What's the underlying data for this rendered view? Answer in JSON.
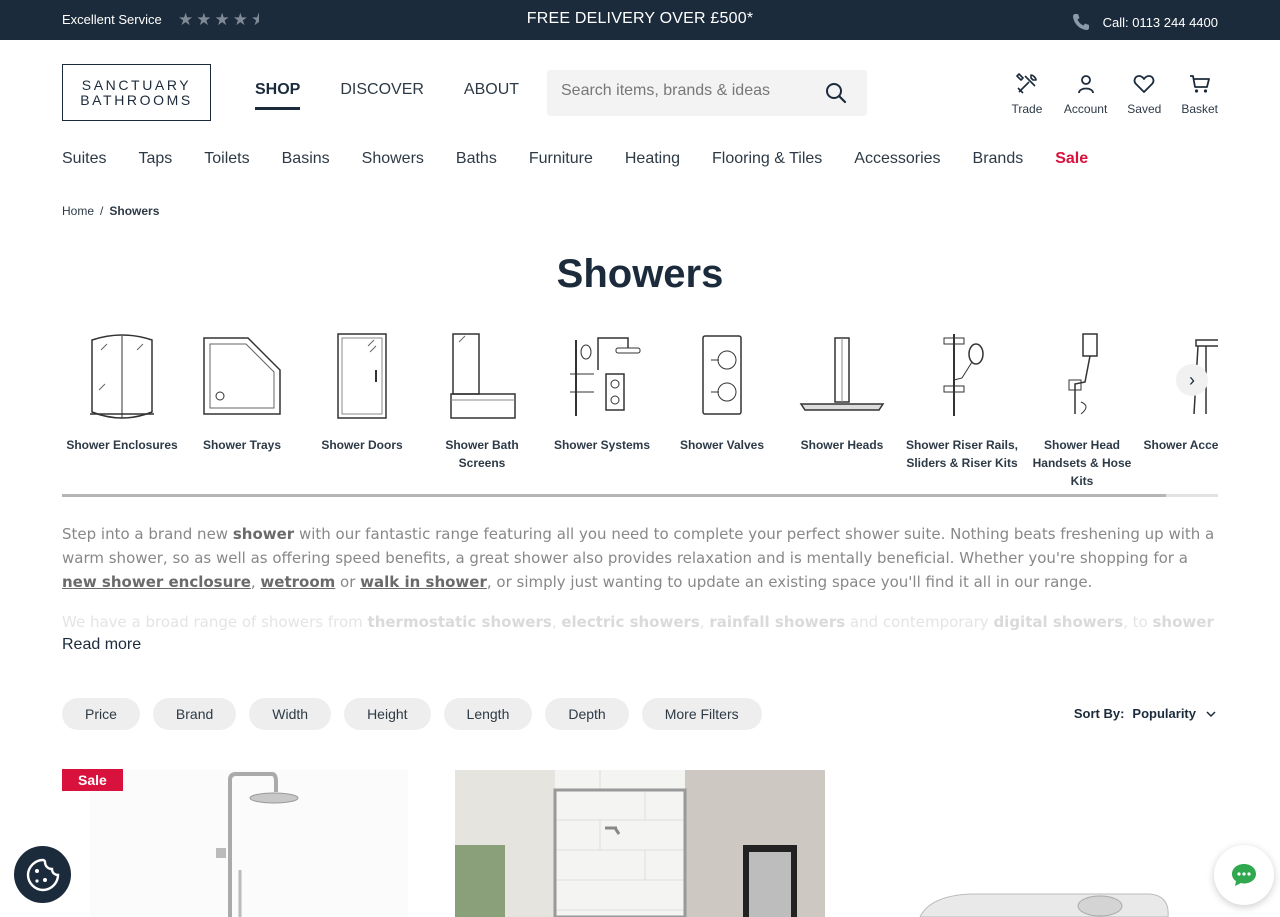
{
  "topbar": {
    "service_label": "Excellent Service",
    "rating": 4.5,
    "promo": "FREE DELIVERY OVER £500*",
    "call": "Call: 0113 244 4400"
  },
  "logo": {
    "line1": "SANCTUARY",
    "line2": "BATHROOMS"
  },
  "main_nav": {
    "shop": "SHOP",
    "discover": "DISCOVER",
    "about": "ABOUT"
  },
  "search": {
    "placeholder": "Search items, brands & ideas",
    "value": ""
  },
  "header_icons": {
    "trade": "Trade",
    "account": "Account",
    "saved": "Saved",
    "basket": "Basket"
  },
  "categories_nav": [
    "Suites",
    "Taps",
    "Toilets",
    "Basins",
    "Showers",
    "Baths",
    "Furniture",
    "Heating",
    "Flooring & Tiles",
    "Accessories",
    "Brands",
    "Sale"
  ],
  "breadcrumb": {
    "home": "Home",
    "separator": "/",
    "current": "Showers"
  },
  "page_title": "Showers",
  "subcategories": [
    {
      "label": "Shower Enclosures",
      "icon": "shower-enclosure-icon"
    },
    {
      "label": "Shower Trays",
      "icon": "shower-tray-icon"
    },
    {
      "label": "Shower Doors",
      "icon": "shower-door-icon"
    },
    {
      "label": "Shower Bath Screens",
      "icon": "bath-screen-icon"
    },
    {
      "label": "Shower Systems",
      "icon": "shower-system-icon"
    },
    {
      "label": "Shower Valves",
      "icon": "shower-valve-icon"
    },
    {
      "label": "Shower Heads",
      "icon": "shower-head-icon"
    },
    {
      "label": "Shower Riser Rails, Sliders & Riser Kits",
      "icon": "riser-rail-icon"
    },
    {
      "label": "Shower Head Handsets & Hose Kits",
      "icon": "handset-icon"
    },
    {
      "label": "Shower Accessories",
      "icon": "shower-seat-icon"
    }
  ],
  "description": {
    "p1_a": "Step into a brand new ",
    "p1_b": "shower",
    "p1_c": " with our fantastic range featuring all you need to complete your perfect shower suite. Nothing beats freshening up with a warm shower, so as well as offering speed benefits, a great shower also provides relaxation and is mentally beneficial. Whether you're shopping for a ",
    "link1": "new shower enclosure",
    "p1_d": ", ",
    "link2": "wetroom",
    "p1_e": " or ",
    "link3": "walk in shower",
    "p1_f": ", or simply just wanting to update an existing space you'll find it all in our range.",
    "p2_a": "We have a broad range of showers from ",
    "p2_b": "thermostatic showers",
    "p2_c": ", ",
    "p2_d": "electric showers",
    "p2_e": ", ",
    "p2_f": "rainfall showers",
    "p2_g": " and contemporary ",
    "p2_h": "digital showers",
    "p2_i": ", to ",
    "p2_j": "shower",
    "read_more": "Read more"
  },
  "filters": [
    "Price",
    "Brand",
    "Width",
    "Height",
    "Length",
    "Depth",
    "More Filters"
  ],
  "sort": {
    "label": "Sort By:",
    "value": "Popularity"
  },
  "products": {
    "badge": "Sale"
  },
  "colors": {
    "navy": "#1c2b3b",
    "sale_red": "#d8123c",
    "chip_bg": "#eeeeee",
    "chat_green": "#2fa84f"
  }
}
